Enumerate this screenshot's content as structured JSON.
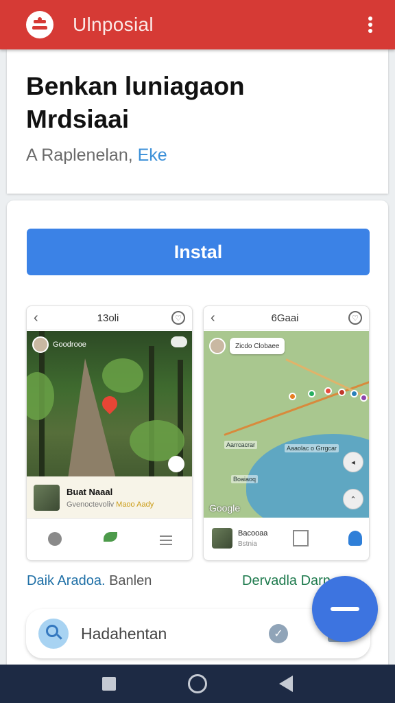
{
  "appbar": {
    "title": "Ulnposial",
    "menu_icon": "overflow-menu-icon"
  },
  "header": {
    "title_line1": "Benkan luniagaon",
    "title_line2": "Mrdsiaai",
    "subtitle_prefix": "A Raplenelan, ",
    "subtitle_link": "Eke"
  },
  "install": {
    "label": "Instal"
  },
  "screenshot_left": {
    "title": "13oli",
    "top_label": "Goodrooe",
    "user_name": "Buat Naaal",
    "user_sub": "Gvenoctevoliv",
    "user_badge": "Maoo Aady"
  },
  "screenshot_right": {
    "title": "6Gaai",
    "chip": "Zicdo Clobaee",
    "map_labels": [
      "Aarrcacrar",
      "Aaaolac o Grrgcar",
      "Boaiaoq"
    ],
    "google": "Google",
    "user_name": "Bacooaa",
    "user_sub": "Bstnia"
  },
  "captions": {
    "left_main": "Daik Aradoa.",
    "left_grey": " Banlen",
    "right": "Dervadla Darn"
  },
  "search": {
    "text": "Hadahentan"
  },
  "colors": {
    "appbar": "#d63a35",
    "accent": "#3b82e6",
    "fab": "#3d74e0",
    "nav": "#1d2a44"
  }
}
